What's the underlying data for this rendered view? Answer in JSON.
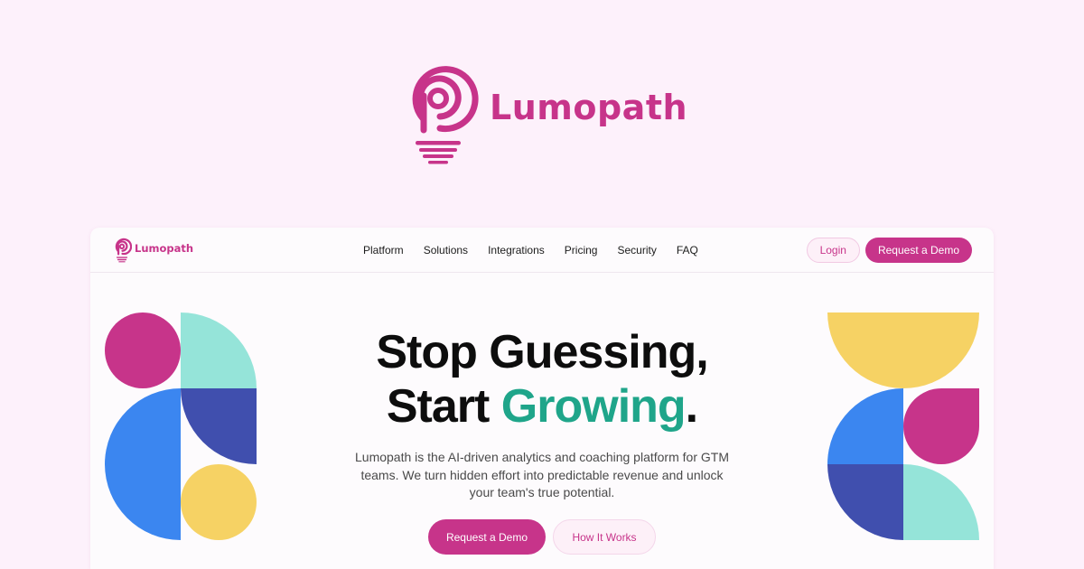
{
  "brand": {
    "name": "Lumopath",
    "color": "#c7348a"
  },
  "navbar": {
    "logo_text": "Lumopath",
    "links": [
      "Platform",
      "Solutions",
      "Integrations",
      "Pricing",
      "Security",
      "FAQ"
    ],
    "login_label": "Login",
    "demo_label": "Request a Demo"
  },
  "hero": {
    "headline_line1": "Stop Guessing,",
    "headline_line2_prefix": "Start ",
    "headline_line2_accent": "Growing",
    "headline_line2_suffix": ".",
    "subtitle": "Lumopath is the AI-driven analytics and coaching platform for GTM teams. We turn hidden effort into predictable revenue and unlock your team's true potential.",
    "primary_cta": "Request a Demo",
    "secondary_cta": "How It Works"
  },
  "icons": {
    "logo": "lightbulb-p-icon"
  },
  "colors": {
    "magenta": "#c7348a",
    "teal_text": "#1fa58a",
    "mint": "#95e4d9",
    "blue": "#3b86f0",
    "navy": "#404fae",
    "yellow": "#f6d264",
    "page_bg": "#fdf1fb"
  }
}
